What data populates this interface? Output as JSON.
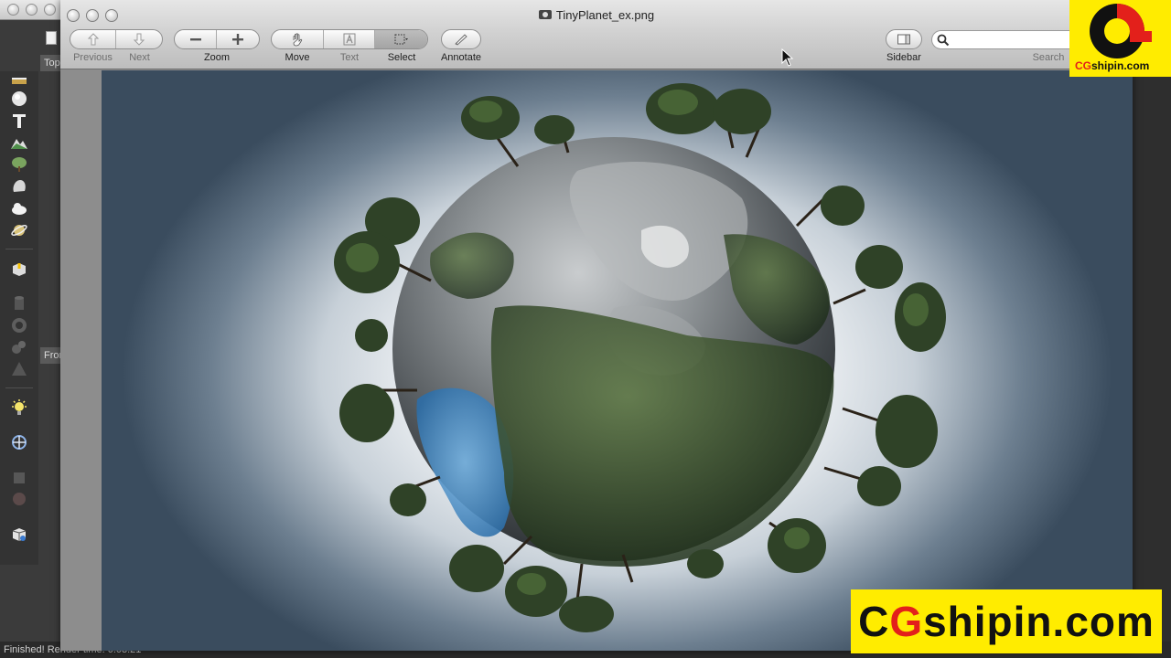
{
  "background_app": {
    "tab_top": "Top",
    "tab_front": "Front",
    "status": "Finished! Render time: 0:03:21"
  },
  "window": {
    "title": "TinyPlanet_ex.png"
  },
  "toolbar": {
    "previous_label": "Previous",
    "next_label": "Next",
    "zoom_label": "Zoom",
    "move_label": "Move",
    "text_label": "Text",
    "select_label": "Select",
    "annotate_label": "Annotate",
    "sidebar_label": "Sidebar",
    "search_label": "Search"
  },
  "search": {
    "placeholder": ""
  },
  "icons": {
    "previous": "up-arrow-icon",
    "next": "down-arrow-icon",
    "zoom_out": "minus-icon",
    "zoom_in": "plus-icon",
    "move": "hand-icon",
    "text": "text-cursor-icon",
    "select": "marquee-select-icon",
    "annotate": "pencil-icon",
    "sidebar": "sidebar-icon",
    "search": "magnifier-icon"
  },
  "watermark": {
    "logo_text_left": "CG",
    "logo_text_right": "shipin.com",
    "banner_c": "C",
    "banner_g": "G",
    "banner_rest": "shipin.com"
  },
  "colors": {
    "watermark_yellow": "#ffec00",
    "watermark_red": "#e3201b"
  }
}
